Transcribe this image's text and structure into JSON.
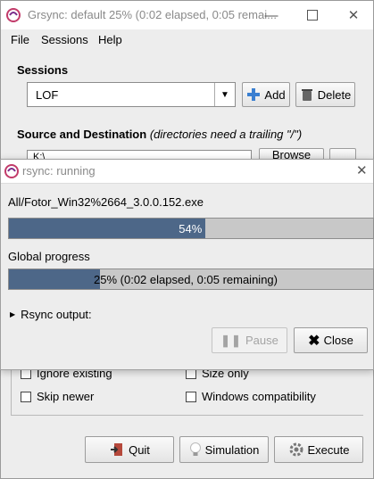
{
  "main_window": {
    "title": "Grsync: default 25% (0:02 elapsed, 0:05 remaining)",
    "title_display": "Grsync: default 25% (0:02 elapsed, 0:05 remai...",
    "menu": [
      "File",
      "Sessions",
      "Help"
    ],
    "sessions_label": "Sessions",
    "session_value": "LOF",
    "add_label": "Add",
    "delete_label": "Delete",
    "src_dest_label": "Source and Destination",
    "src_dest_hint": "(directories need a trailing \"/\")",
    "source_value": "K:\\",
    "browse_label": "Browse",
    "options": {
      "ignore_existing": "Ignore existing",
      "size_only": "Size only",
      "skip_newer": "Skip newer",
      "windows_compat": "Windows compatibility"
    },
    "quit_label": "Quit",
    "simulation_label": "Simulation",
    "execute_label": "Execute"
  },
  "dialog": {
    "title": "rsync: running",
    "file_name": "All/Fotor_Win32%2664_3.0.0.152.exe",
    "file_progress": 54,
    "file_progress_text": "54%",
    "global_label": "Global progress",
    "global_progress": 25,
    "global_progress_text": "25% (0:02 elapsed, 0:05 remaining)",
    "rsync_output_label": "Rsync output:",
    "pause_label": "Pause",
    "close_label": "Close"
  }
}
